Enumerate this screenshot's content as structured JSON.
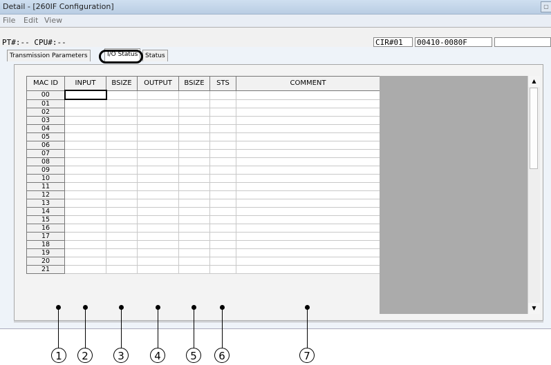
{
  "window": {
    "title": "Detail - [260IF Configuration]"
  },
  "menu": [
    "File",
    "Edit",
    "View"
  ],
  "info": {
    "pt_cpu": "PT#:-- CPU#:--",
    "cir": "CIR#01",
    "code": "00410-0080F",
    "extra": ""
  },
  "tabs": [
    {
      "label": "Transmission Parameters",
      "active": false
    },
    {
      "label": "I/O Status",
      "active": true
    },
    {
      "label": "Status",
      "active": false
    }
  ],
  "table": {
    "columns": [
      "MAC ID",
      "INPUT",
      "BSIZE",
      "OUTPUT",
      "BSIZE",
      "STS",
      "COMMENT"
    ],
    "rows": [
      "00",
      "01",
      "02",
      "03",
      "04",
      "05",
      "06",
      "07",
      "08",
      "09",
      "10",
      "11",
      "12",
      "13",
      "14",
      "15",
      "16",
      "17",
      "18",
      "19",
      "20",
      "21"
    ]
  },
  "callouts": [
    "1",
    "2",
    "3",
    "4",
    "5",
    "6",
    "7"
  ]
}
